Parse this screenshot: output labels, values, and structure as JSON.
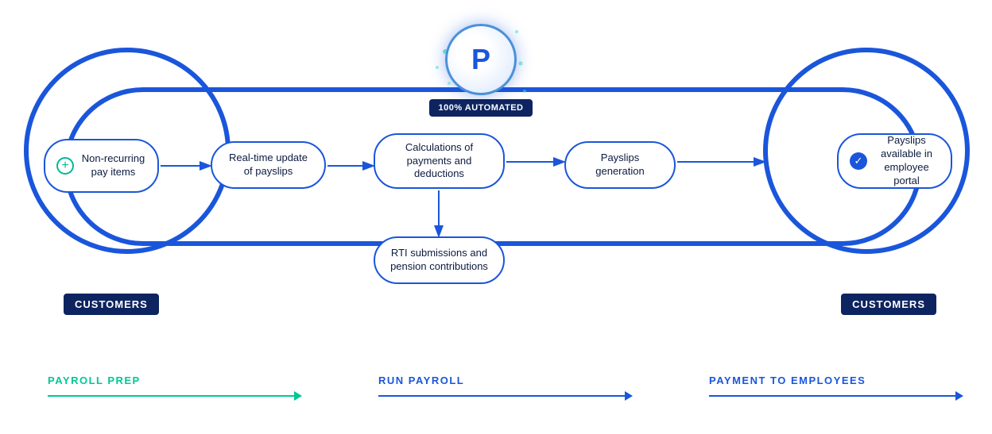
{
  "diagram": {
    "logo_letter": "P",
    "automated_badge": "100% AUTOMATED",
    "nodes": [
      {
        "id": "node-1",
        "text": "Non-recurring pay items",
        "icon": "plus"
      },
      {
        "id": "node-2",
        "text": "Real-time update of payslips",
        "icon": null
      },
      {
        "id": "node-3",
        "text": "Calculations of payments and deductions",
        "icon": null
      },
      {
        "id": "node-4",
        "text": "RTI submissions and pension contributions",
        "icon": null
      },
      {
        "id": "node-5",
        "text": "Payslips generation",
        "icon": null
      },
      {
        "id": "node-6",
        "text": "Payslips available in employee portal",
        "icon": "check"
      }
    ],
    "customers_left": "CUSTOMERS",
    "customers_right": "CUSTOMERS"
  },
  "phases": [
    {
      "id": "payroll-prep",
      "title": "PAYROLL PREP",
      "color": "teal"
    },
    {
      "id": "run-payroll",
      "title": "RUN PAYROLL",
      "color": "blue"
    },
    {
      "id": "payment-to-employees",
      "title": "PAYMENT TO EMPLOYEES",
      "color": "blue"
    }
  ]
}
